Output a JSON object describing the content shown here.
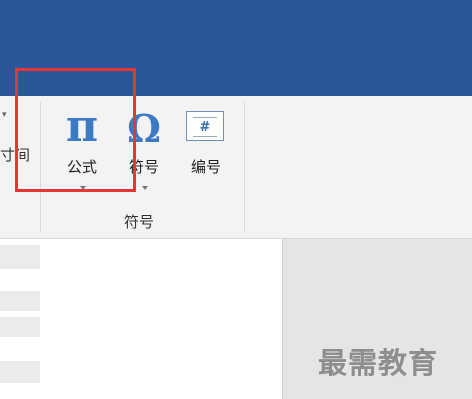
{
  "ribbon": {
    "partial_label": "寸间",
    "group_label": "符号",
    "buttons": [
      {
        "label": "公式",
        "icon": "pi-icon",
        "glyph": "π",
        "has_dropdown": true
      },
      {
        "label": "符号",
        "icon": "omega-icon",
        "glyph": "Ω",
        "has_dropdown": true
      },
      {
        "label": "编号",
        "icon": "number-icon",
        "glyph": "#",
        "has_dropdown": false
      }
    ]
  },
  "watermark": "最需教育",
  "colors": {
    "title_bar": "#2b579a",
    "ribbon": "#f3f3f3",
    "icon_blue": "#3d7ac4",
    "highlight": "#e53535"
  }
}
